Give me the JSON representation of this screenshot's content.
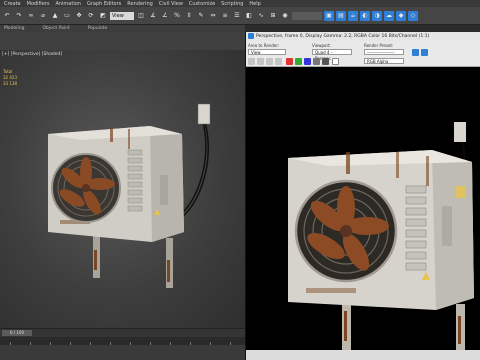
{
  "menu": [
    "Create",
    "Modifiers",
    "Animation",
    "Graph Editors",
    "Rendering",
    "Civil View",
    "Customize",
    "Scripting",
    "Help"
  ],
  "toolbar": {
    "view_dropdown": "View"
  },
  "ribbon": {
    "left": "Modeling",
    "mid": "Object Paint",
    "right": "Populate"
  },
  "viewport": {
    "label": "[+] [Perspective] [Shaded]",
    "stats": [
      "Total",
      "32 423",
      "33 138"
    ],
    "timeline": "0 / 100"
  },
  "render_window": {
    "title": "Perspective, frame 0, Display Gamma: 2.2, RGBA Color 16 Bits/Channel (1:1)",
    "area_label": "Area to Render:",
    "area_value": "View",
    "viewport_label": "Viewport:",
    "viewport_value": "Quad 4 - Perspec",
    "preset_label": "Render Preset:",
    "preset_value": "-------------------",
    "channel_value": "RGB Alpha"
  },
  "colors": {
    "accent_blue": "#2f7fd6",
    "stats_yellow": "#e8c44a",
    "rust": "#7a4522"
  }
}
